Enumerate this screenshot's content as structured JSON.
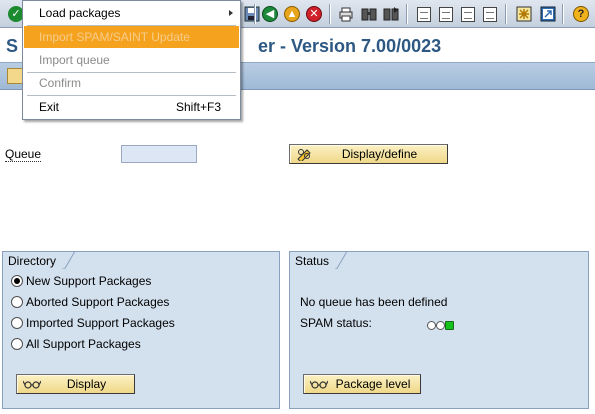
{
  "window": {
    "title_prefix": "S",
    "title_suffix": "er - Version 7.00/0023"
  },
  "menu": {
    "items": [
      {
        "label": "Load packages",
        "state": "enabled",
        "submenu": true
      },
      {
        "label": "Import SPAM/SAINT Update",
        "state": "highlighted-disabled"
      },
      {
        "label": "Import queue",
        "state": "disabled"
      },
      {
        "label": "Confirm",
        "state": "disabled"
      },
      {
        "label": "Exit",
        "accelerator": "Shift+F3",
        "state": "enabled"
      }
    ]
  },
  "queue": {
    "label": "Queue",
    "value": "",
    "display_define_button": "Display/define"
  },
  "directory": {
    "title": "Directory",
    "options": [
      {
        "label": "New Support Packages",
        "checked": true
      },
      {
        "label": "Aborted Support Packages",
        "checked": false
      },
      {
        "label": "Imported Support Packages",
        "checked": false
      },
      {
        "label": "All Support Packages",
        "checked": false
      }
    ],
    "display_button": "Display"
  },
  "status": {
    "title": "Status",
    "message": "No queue has been defined",
    "spam_status_label": "SPAM status:",
    "lights": [
      "off",
      "off",
      "green"
    ],
    "package_level_button": "Package level"
  },
  "colors": {
    "title_blue": "#2d5883",
    "menu_highlight": "#f5a21f",
    "group_bg": "#d3e0ee",
    "button_bg": "#f0d888",
    "status_green": "#13c21a"
  },
  "toolbar_icons": [
    "enter-icon",
    "save-icon",
    "back-icon",
    "exit-icon",
    "cancel-icon",
    "print-icon",
    "find-icon",
    "find-next-icon",
    "first-page-icon",
    "previous-page-icon",
    "next-page-icon",
    "last-page-icon",
    "create-session-icon",
    "shortcut-icon",
    "help-icon"
  ]
}
